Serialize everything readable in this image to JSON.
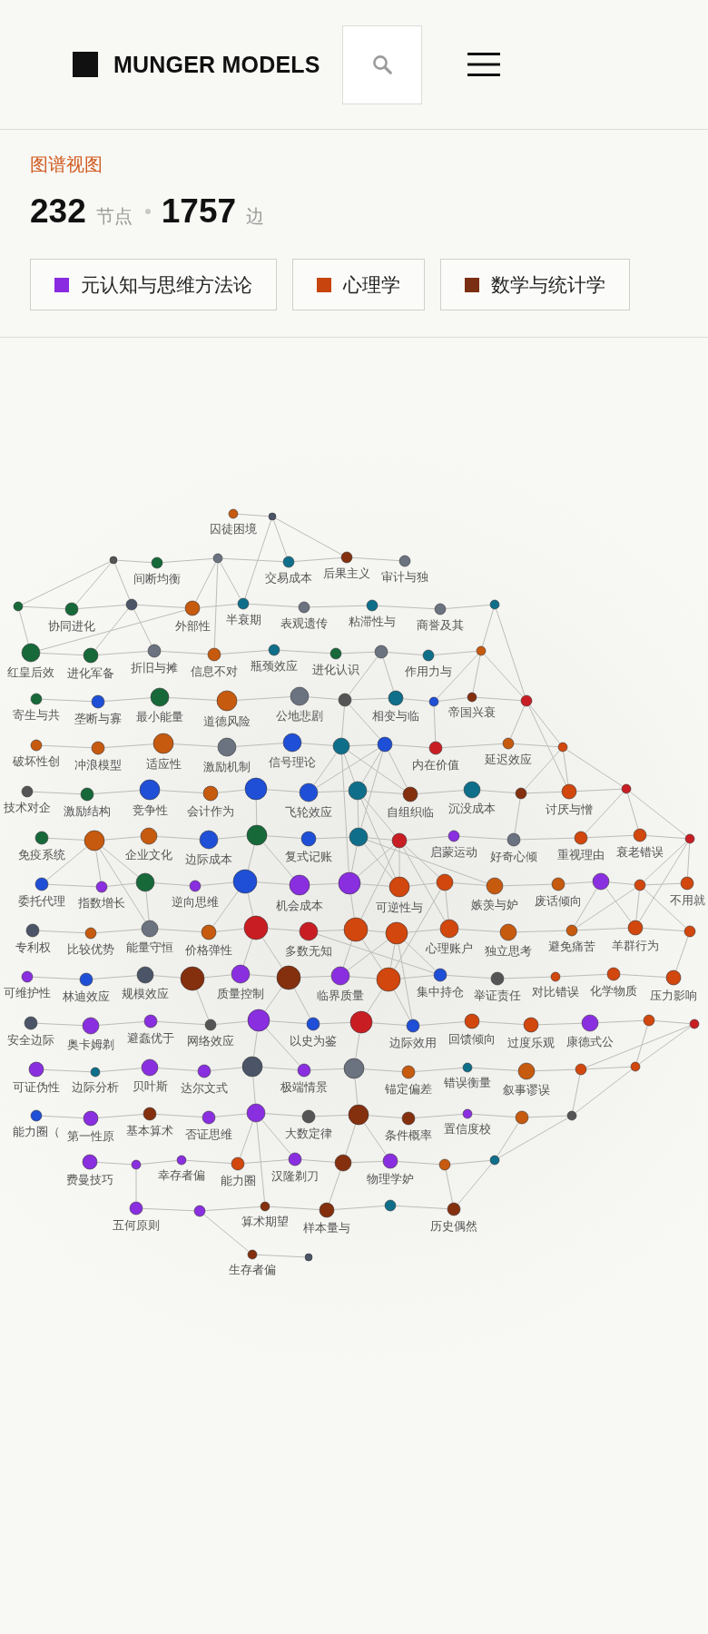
{
  "header": {
    "brand": "MUNGER MODELS"
  },
  "view": {
    "title": "图谱视图",
    "node_count": "232",
    "node_unit": "节点",
    "edge_count": "1757",
    "edge_unit": "边"
  },
  "categories": [
    {
      "label": "元认知与思维方法论",
      "color": "#8a2be2"
    },
    {
      "label": "心理学",
      "color": "#c8440e"
    },
    {
      "label": "数学与统计学",
      "color": "#7a2e12"
    }
  ],
  "graph": {
    "nodes": [
      {
        "label": "囚徒困境",
        "color": "#c65a0f"
      },
      {
        "color": "#4b5567"
      },
      {
        "color": "#555555"
      },
      {
        "label": "间断均衡",
        "color": "#17693a"
      },
      {
        "color": "#6b7280"
      },
      {
        "label": "交易成本",
        "color": "#0f6f8a"
      },
      {
        "label": "后果主义",
        "color": "#84300f"
      },
      {
        "label": "审计与独",
        "color": "#6b7280"
      },
      {
        "color": "#17693a"
      },
      {
        "label": "协同进化",
        "color": "#17693a"
      },
      {
        "color": "#4b5567"
      },
      {
        "label": "外部性",
        "color": "#c65a0f"
      },
      {
        "label": "半衰期",
        "color": "#0f6f8a"
      },
      {
        "label": "表观遗传",
        "color": "#6b7280"
      },
      {
        "label": "粘滞性与",
        "color": "#0f6f8a"
      },
      {
        "label": "商誉及其",
        "color": "#6b7280"
      },
      {
        "color": "#0f6f8a"
      },
      {
        "label": "红皇后效",
        "color": "#17693a"
      },
      {
        "label": "进化军备",
        "color": "#17693a"
      },
      {
        "label": "折旧与摊",
        "color": "#6b7280"
      },
      {
        "label": "信息不对",
        "color": "#c65a0f"
      },
      {
        "label": "瓶颈效应",
        "color": "#0f6f8a"
      },
      {
        "label": "进化认识",
        "color": "#17693a"
      },
      {
        "color": "#6b7280"
      },
      {
        "label": "作用力与",
        "color": "#0f6f8a"
      },
      {
        "color": "#c65a0f"
      },
      {
        "label": "寄生与共",
        "color": "#17693a"
      },
      {
        "label": "垄断与寡",
        "color": "#1f4fd6"
      },
      {
        "label": "最小能量",
        "color": "#17693a"
      },
      {
        "label": "道德风险",
        "color": "#c65a0f"
      },
      {
        "label": "公地悲剧",
        "color": "#6b7280"
      },
      {
        "color": "#555555"
      },
      {
        "label": "相变与临",
        "color": "#0f6f8a"
      },
      {
        "color": "#1f4fd6"
      },
      {
        "label": "帝国兴衰",
        "color": "#84300f"
      },
      {
        "color": "#c81e23"
      },
      {
        "label": "破坏性创",
        "color": "#c65a0f"
      },
      {
        "label": "冲浪模型",
        "color": "#c65a0f"
      },
      {
        "label": "适应性",
        "color": "#c65a0f"
      },
      {
        "label": "激励机制",
        "color": "#6b7280"
      },
      {
        "label": "信号理论",
        "color": "#1f4fd6"
      },
      {
        "color": "#0f6f8a"
      },
      {
        "color": "#1f4fd6"
      },
      {
        "label": "内在价值",
        "color": "#c81e23"
      },
      {
        "label": "延迟效应",
        "color": "#c65a0f"
      },
      {
        "color": "#d1470e"
      },
      {
        "label": "技术对企",
        "color": "#555555"
      },
      {
        "label": "激励结构",
        "color": "#17693a"
      },
      {
        "label": "竞争性",
        "color": "#1f4fd6"
      },
      {
        "label": "会计作为",
        "color": "#c65a0f"
      },
      {
        "color": "#1f4fd6"
      },
      {
        "label": "飞轮效应",
        "color": "#1f4fd6"
      },
      {
        "color": "#0f6f8a"
      },
      {
        "label": "自组织临",
        "color": "#84300f"
      },
      {
        "label": "沉没成本",
        "color": "#0f6f8a"
      },
      {
        "color": "#84300f"
      },
      {
        "label": "讨厌与憎",
        "color": "#d1470e"
      },
      {
        "color": "#c81e23"
      },
      {
        "label": "免疫系统",
        "color": "#17693a"
      },
      {
        "color": "#c65a0f"
      },
      {
        "label": "企业文化",
        "color": "#c65a0f"
      },
      {
        "label": "边际成本",
        "color": "#1f4fd6"
      },
      {
        "color": "#17693a"
      },
      {
        "label": "复式记账",
        "color": "#1f4fd6"
      },
      {
        "color": "#0f6f8a"
      },
      {
        "color": "#c81e23"
      },
      {
        "label": "启蒙运动",
        "color": "#8a2fe0"
      },
      {
        "label": "好奇心倾",
        "color": "#6b7280"
      },
      {
        "label": "重视理由",
        "color": "#d1470e"
      },
      {
        "label": "衰老错误",
        "color": "#d1470e"
      },
      {
        "color": "#c81e23"
      },
      {
        "label": "委托代理",
        "color": "#1f4fd6"
      },
      {
        "label": "指数增长",
        "color": "#8a2fe0"
      },
      {
        "color": "#17693a"
      },
      {
        "label": "逆向思维",
        "color": "#8a2fe0"
      },
      {
        "color": "#1f4fd6"
      },
      {
        "label": "机会成本",
        "color": "#8a2fe0"
      },
      {
        "color": "#8a2fe0"
      },
      {
        "label": "可逆性与",
        "color": "#d1470e"
      },
      {
        "color": "#d1470e"
      },
      {
        "label": "嫉羡与妒",
        "color": "#c65a0f"
      },
      {
        "label": "废话倾向",
        "color": "#c65a0f"
      },
      {
        "color": "#8a2fe0"
      },
      {
        "color": "#d1470e"
      },
      {
        "label": "不用就",
        "color": "#d1470e"
      },
      {
        "label": "专利权",
        "color": "#4b5567"
      },
      {
        "label": "比较优势",
        "color": "#c65a0f"
      },
      {
        "label": "能量守恒",
        "color": "#6b7280"
      },
      {
        "label": "价格弹性",
        "color": "#c65a0f"
      },
      {
        "color": "#c81e23"
      },
      {
        "label": "多数无知",
        "color": "#c81e23"
      },
      {
        "color": "#d1470e"
      },
      {
        "color": "#d1470e"
      },
      {
        "label": "心理账户",
        "color": "#d1470e"
      },
      {
        "label": "独立思考",
        "color": "#c65a0f"
      },
      {
        "label": "避免痛苦",
        "color": "#c65a0f"
      },
      {
        "label": "羊群行为",
        "color": "#d1470e"
      },
      {
        "color": "#d1470e"
      },
      {
        "label": "可维护性",
        "color": "#8a2fe0"
      },
      {
        "label": "林迪效应",
        "color": "#1f4fd6"
      },
      {
        "label": "规模效应",
        "color": "#4b5567"
      },
      {
        "color": "#84300f"
      },
      {
        "label": "质量控制",
        "color": "#8a2fe0"
      },
      {
        "color": "#84300f"
      },
      {
        "label": "临界质量",
        "color": "#8a2fe0"
      },
      {
        "color": "#d1470e"
      },
      {
        "label": "集中持仓",
        "color": "#1f4fd6"
      },
      {
        "label": "举证责任",
        "color": "#555555"
      },
      {
        "label": "对比错误",
        "color": "#d1470e"
      },
      {
        "label": "化学物质",
        "color": "#d1470e"
      },
      {
        "label": "压力影响",
        "color": "#d1470e"
      },
      {
        "label": "安全边际",
        "color": "#4b5567"
      },
      {
        "label": "奥卡姆剃",
        "color": "#8a2fe0"
      },
      {
        "label": "避蠢优于",
        "color": "#8a2fe0"
      },
      {
        "label": "网络效应",
        "color": "#555555"
      },
      {
        "color": "#8a2fe0"
      },
      {
        "label": "以史为鉴",
        "color": "#1f4fd6"
      },
      {
        "color": "#c81e23"
      },
      {
        "label": "边际效用",
        "color": "#1f4fd6"
      },
      {
        "label": "回馈倾向",
        "color": "#d1470e"
      },
      {
        "label": "过度乐观",
        "color": "#d1470e"
      },
      {
        "label": "康德式公",
        "color": "#8a2fe0"
      },
      {
        "color": "#d1470e"
      },
      {
        "color": "#c81e23"
      },
      {
        "label": "可证伪性",
        "color": "#8a2fe0"
      },
      {
        "label": "边际分析",
        "color": "#0f6f8a"
      },
      {
        "label": "贝叶斯",
        "color": "#8a2fe0"
      },
      {
        "label": "达尔文式",
        "color": "#8a2fe0"
      },
      {
        "color": "#4b5567"
      },
      {
        "label": "极端情景",
        "color": "#8a2fe0"
      },
      {
        "color": "#6b7280"
      },
      {
        "label": "锚定偏差",
        "color": "#c65a0f"
      },
      {
        "label": "错误衡量",
        "color": "#0f6f8a"
      },
      {
        "label": "叙事谬误",
        "color": "#c65a0f"
      },
      {
        "color": "#d1470e"
      },
      {
        "color": "#d1470e"
      },
      {
        "label": "能力圈（",
        "color": "#1f4fd6"
      },
      {
        "label": "第一性原",
        "color": "#8a2fe0"
      },
      {
        "label": "基本算术",
        "color": "#84300f"
      },
      {
        "label": "否证思维",
        "color": "#8a2fe0"
      },
      {
        "color": "#8a2fe0"
      },
      {
        "label": "大数定律",
        "color": "#555555"
      },
      {
        "color": "#84300f"
      },
      {
        "label": "条件概率",
        "color": "#84300f"
      },
      {
        "label": "置信度校",
        "color": "#8a2fe0"
      },
      {
        "color": "#c65a0f"
      },
      {
        "color": "#555555"
      },
      {
        "label": "费曼技巧",
        "color": "#8a2fe0"
      },
      {
        "color": "#8a2fe0"
      },
      {
        "label": "幸存者偏",
        "color": "#8a2fe0"
      },
      {
        "label": "能力圈",
        "color": "#d1470e"
      },
      {
        "label": "汉隆剃刀",
        "color": "#8a2fe0"
      },
      {
        "color": "#84300f"
      },
      {
        "label": "物理学妒",
        "color": "#8a2fe0"
      },
      {
        "color": "#c65a0f"
      },
      {
        "color": "#0f6f8a"
      },
      {
        "label": "五何原则",
        "color": "#8a2fe0"
      },
      {
        "color": "#8a2fe0"
      },
      {
        "label": "算术期望",
        "color": "#84300f"
      },
      {
        "label": "样本量与",
        "color": "#84300f"
      },
      {
        "color": "#0f6f8a"
      },
      {
        "label": "历史偶然",
        "color": "#84300f"
      },
      {
        "label": "生存者偏",
        "color": "#84300f"
      },
      {
        "color": "#4b5567"
      }
    ]
  }
}
